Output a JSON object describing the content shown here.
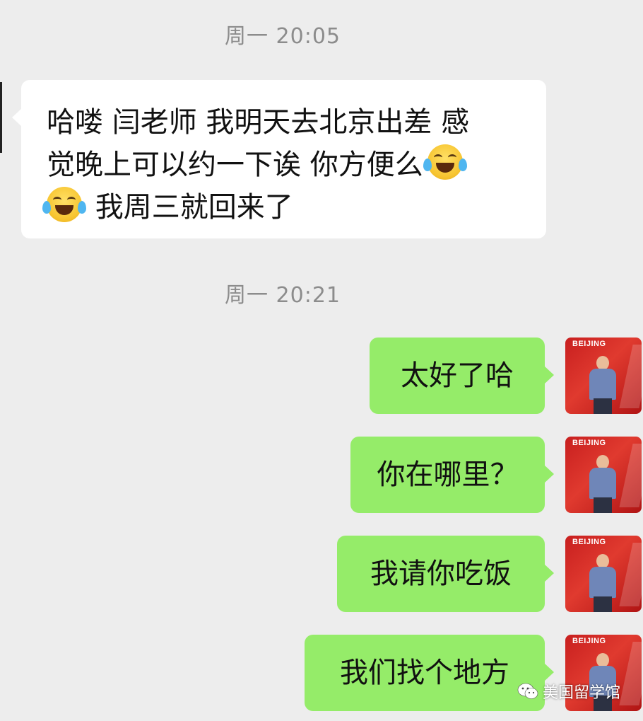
{
  "timestamps": [
    "周一 20:05",
    "周一 20:21"
  ],
  "incoming_message": {
    "line1": "哈喽 闫老师 我明天去北京出差 感",
    "line2": "觉晚上可以约一下诶 你方便么",
    "line3": "我周三就回来了",
    "emoji_icon": "tears-of-joy-emoji-icon"
  },
  "outgoing_messages": [
    {
      "text": "太好了哈"
    },
    {
      "text": "你在哪里？"
    },
    {
      "text": "我请你吃饭"
    },
    {
      "text": "我们找个地方"
    }
  ],
  "avatar": {
    "label": "BEIJING"
  },
  "watermark": {
    "text": "美国留学馆",
    "icon": "wechat-icon"
  },
  "colors": {
    "background": "#ededed",
    "incoming_bubble": "#ffffff",
    "outgoing_bubble": "#95ec69",
    "timestamp_text": "#8c8c8c"
  }
}
